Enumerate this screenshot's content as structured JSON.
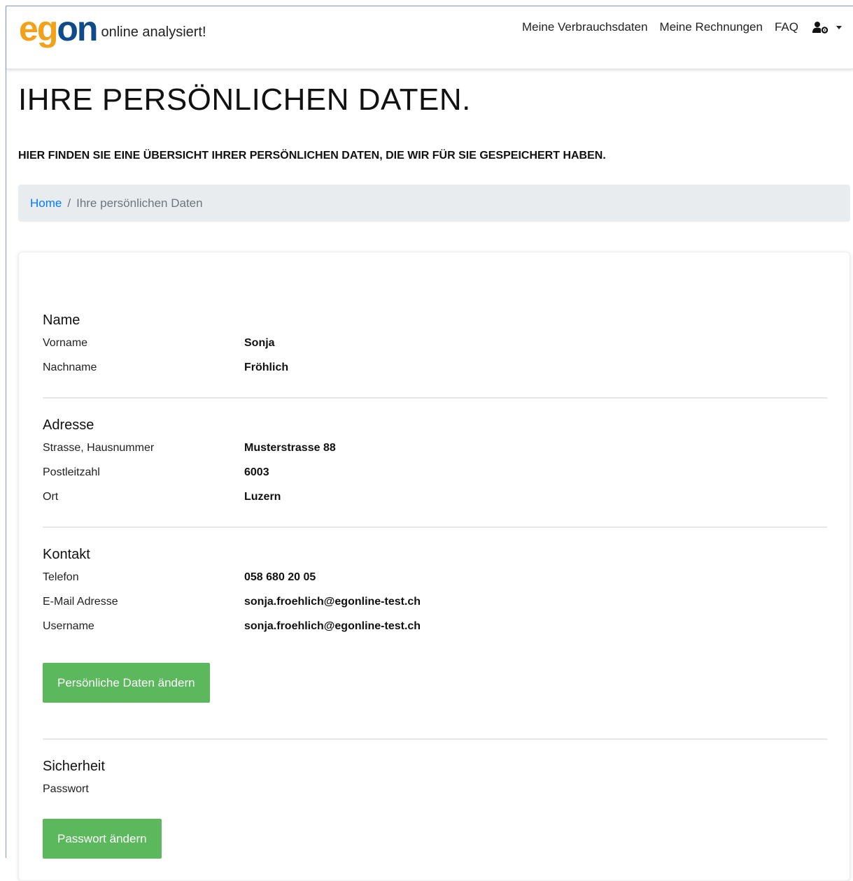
{
  "header": {
    "logo_e": "e",
    "logo_g": "g",
    "logo_on": "on",
    "logo_sub": "online analysiert!",
    "nav": [
      "Meine Verbrauchsdaten",
      "Meine Rechnungen",
      "FAQ"
    ],
    "user_icon": "user-cog-icon",
    "colors": {
      "logo_orange": "#f2a11b",
      "logo_blue": "#0e4b8a"
    }
  },
  "page": {
    "title": "IHRE PERSÖNLICHEN DATEN.",
    "subtitle": "HIER FINDEN SIE EINE ÜBERSICHT IHRER PERSÖNLICHEN DATEN, DIE WIR FÜR SIE GESPEICHERT HABEN."
  },
  "breadcrumb": {
    "home": "Home",
    "separator": "/",
    "current": "Ihre persönlichen Daten"
  },
  "sections": {
    "name": {
      "title": "Name",
      "rows": [
        {
          "label": "Vorname",
          "value": "Sonja"
        },
        {
          "label": "Nachname",
          "value": "Fröhlich"
        }
      ]
    },
    "adresse": {
      "title": "Adresse",
      "rows": [
        {
          "label": "Strasse, Hausnummer",
          "value": "Musterstrasse 88"
        },
        {
          "label": "Postleitzahl",
          "value": "6003"
        },
        {
          "label": "Ort",
          "value": "Luzern"
        }
      ]
    },
    "kontakt": {
      "title": "Kontakt",
      "rows": [
        {
          "label": "Telefon",
          "value": "058 680 20 05"
        },
        {
          "label": "E-Mail Adresse",
          "value": "sonja.froehlich@egonline-test.ch"
        },
        {
          "label": "Username",
          "value": "sonja.froehlich@egonline-test.ch"
        }
      ],
      "button": "Persönliche Daten ändern"
    },
    "sicherheit": {
      "title": "Sicherheit",
      "rows": [
        {
          "label": "Passwort",
          "value": ""
        }
      ],
      "button": "Passwort ändern"
    }
  },
  "colors": {
    "link": "#007bff",
    "button_green": "#5cb85c",
    "breadcrumb_bg": "#e9ecef"
  }
}
